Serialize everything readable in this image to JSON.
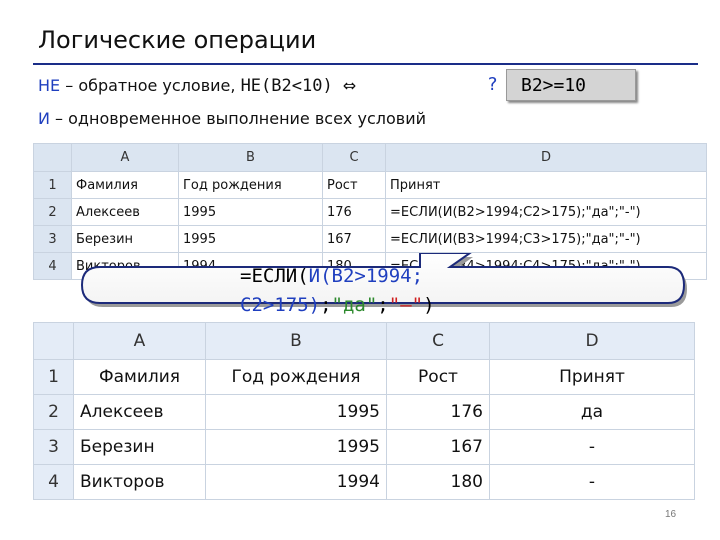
{
  "slide": {
    "title": "Логические операции",
    "page_number": "16"
  },
  "definitions": {
    "not_keyword": "НЕ",
    "not_text": " – обратное условие, ",
    "not_example": "НЕ(B2<10)",
    "equiv_symbol": "⇔",
    "question": "?",
    "answer": "B2>=10",
    "and_keyword": "И",
    "and_text": " – одновременное выполнение всех условий"
  },
  "sheet_formulas": {
    "columns": [
      "A",
      "B",
      "C",
      "D"
    ],
    "header_row": [
      "Фамилия",
      "Год рождения",
      "Рост",
      "Принят"
    ],
    "rows": [
      {
        "num": "1"
      },
      {
        "num": "2",
        "a": "Алексеев",
        "b": "1995",
        "c": "176",
        "d": "=ЕСЛИ(И(B2>1994;C2>175);\"да\";\"-\")"
      },
      {
        "num": "3",
        "a": "Березин",
        "b": "1995",
        "c": "167",
        "d": "=ЕСЛИ(И(B3>1994;C3>175);\"да\";\"-\")"
      },
      {
        "num": "4",
        "a": "Викторов",
        "b": "1994",
        "c": "180",
        "d": "=ЕСЛИ(И(B4>1994;C4>175);\"да\";\"-\")"
      }
    ]
  },
  "callout": {
    "part1": "=ЕСЛИ(",
    "part2": "И(B2>1994;",
    "part3": "C2>175)",
    "part4": ";",
    "part5": "\"да\"",
    "part6": ";",
    "part7": "\"–\"",
    "part8": ")"
  },
  "sheet_values": {
    "columns": [
      "A",
      "B",
      "C",
      "D"
    ],
    "header_row": [
      "Фамилия",
      "Год рождения",
      "Рост",
      "Принят"
    ],
    "rows": [
      {
        "num": "1"
      },
      {
        "num": "2",
        "a": "Алексеев",
        "b": "1995",
        "c": "176",
        "d": "да"
      },
      {
        "num": "3",
        "a": "Березин",
        "b": "1995",
        "c": "167",
        "d": "-"
      },
      {
        "num": "4",
        "a": "Викторов",
        "b": "1994",
        "c": "180",
        "d": "-"
      }
    ]
  },
  "colors": {
    "accent_blue": "#1f3fbf",
    "title_rule": "#1a2d88",
    "callout_green": "#2e8a2e",
    "callout_red": "#d02020"
  }
}
